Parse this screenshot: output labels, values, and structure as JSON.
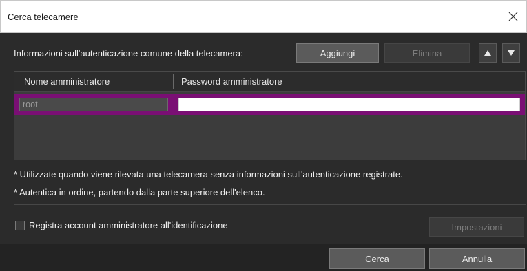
{
  "window": {
    "title": "Cerca telecamere",
    "close_glyph": "✕"
  },
  "auth": {
    "label": "Informazioni sull'autenticazione comune della telecamera:",
    "add_label": "Aggiungi",
    "delete_label": "Elimina",
    "up_icon": "triangle-up-icon",
    "down_icon": "triangle-down-icon",
    "up_glyph": "▲",
    "down_glyph": "▼"
  },
  "table": {
    "columns": [
      "Nome amministratore",
      "Password amministratore"
    ],
    "rows": [
      {
        "user": "root",
        "password": ""
      }
    ]
  },
  "notes": [
    "* Utilizzate quando viene rilevata una telecamera senza informazioni sull'autenticazione registrate.",
    "* Autentica in ordine, partendo dalla parte superiore dell'elenco."
  ],
  "register": {
    "checkbox_label": "Registra account amministratore all'identificazione",
    "checked": false,
    "settings_label": "Impostazioni"
  },
  "footer": {
    "search_label": "Cerca",
    "cancel_label": "Annulla"
  },
  "colors": {
    "selection": "#7a0f74",
    "dialog_bg": "#2b2b2b"
  }
}
